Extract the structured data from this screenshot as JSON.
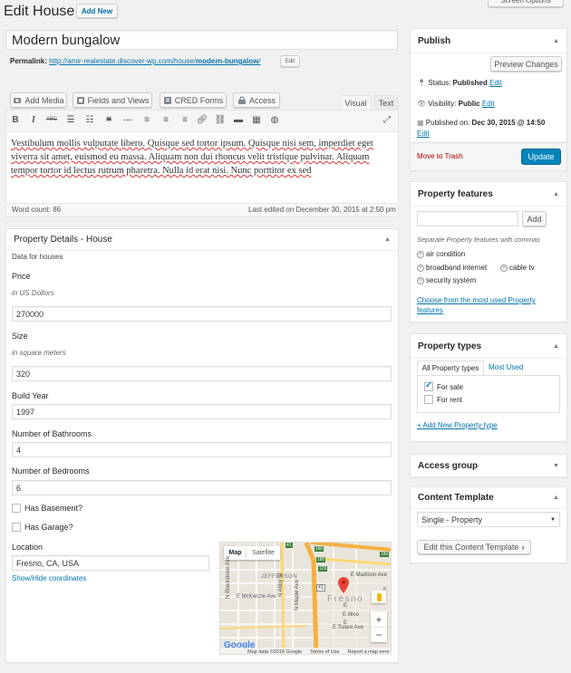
{
  "header": {
    "title": "Edit House",
    "add_new": "Add New",
    "screen_options": "Screen Options"
  },
  "post": {
    "title": "Modern bungalow",
    "permalink_label": "Permalink:",
    "permalink_base": "http://amir-realestate.discover-wp.com/house/",
    "permalink_slug": "modern-bungalow",
    "permalink_tail": "/",
    "edit_label": "Edit"
  },
  "media_buttons": {
    "add_media": "Add Media",
    "fields_views": "Fields and Views",
    "cred_forms": "CRED Forms",
    "access": "Access"
  },
  "editor": {
    "tab_visual": "Visual",
    "tab_text": "Text",
    "content": "Vestibulum mollis vulputate libero. Quisque sed tortor ipsum. Quisque nisi sem, imperdiet eget viverra sit amet, euismod eu massa. Aliquam non dui rhoncus velit tristique pulvinar. Aliquam tempor tortor id lectus rutrum pharetra. Nulla id erat nisi. Nunc porttitor ex sed",
    "word_count": "Word count: 86",
    "last_edited": "Last edited on December 30, 2015 at 2:50 pm"
  },
  "property_details": {
    "title": "Property Details - House",
    "description": "Data for houses",
    "price_label": "Price",
    "price_hint": "in US Dollors",
    "price_value": "270000",
    "size_label": "Size",
    "size_hint": "in square meters",
    "size_value": "320",
    "build_year_label": "Build Year",
    "build_year_value": "1997",
    "bathrooms_label": "Number of Bathrooms",
    "bathrooms_value": "4",
    "bedrooms_label": "Number of Bedrooms",
    "bedrooms_value": "6",
    "basement_label": "Has Basement?",
    "garage_label": "Has Garage?",
    "location_label": "Location",
    "location_value": "Fresno, CA, USA",
    "show_hide": "Show/Hide coordinates"
  },
  "map": {
    "tab_map": "Map",
    "tab_satellite": "Satellite",
    "city": "Fresno",
    "streets": {
      "jefferson": "JEFFERSON",
      "mckenzie": "E McKenzie Ave",
      "madison": "E Madison Ave",
      "blackstone": "N Blackstone Ave",
      "abby": "N Abby St",
      "maple": "N Maple Ave",
      "tulare": "E Tulare Ave",
      "elinor": "E Illino",
      "e": "E",
      "e2": "E",
      "e3": "E"
    },
    "shields": {
      "r180": "180",
      "r41": "41",
      "r180b": "180",
      "r41b": "41",
      "r129": "129",
      "r180c": "180"
    },
    "google": "Google",
    "footer_data": "Map data ©2016 Google",
    "footer_terms": "Terms of Use",
    "footer_report": "Report a map error",
    "zoom_in": "+",
    "zoom_out": "−"
  },
  "publish": {
    "title": "Publish",
    "preview": "Preview Changes",
    "status_label": "Status:",
    "status_value": "Published",
    "visibility_label": "Visibility:",
    "visibility_value": "Public",
    "published_label": "Published on:",
    "published_value": "Dec 30, 2015 @ 14:50",
    "edit": "Edit",
    "trash": "Move to Trash",
    "update": "Update"
  },
  "features": {
    "title": "Property features",
    "add": "Add",
    "hint": "Separate Property features with commas",
    "tags": [
      "air condition",
      "broadband internet",
      "cable tv",
      "security system"
    ],
    "choose": "Choose from the most used Property features"
  },
  "types": {
    "title": "Property types",
    "tab_all": "All Property types",
    "tab_most": "Most Used",
    "items": [
      {
        "label": "For sale",
        "checked": true
      },
      {
        "label": "For rent",
        "checked": false
      }
    ],
    "add_new": "+ Add New Property type"
  },
  "access_group": {
    "title": "Access group"
  },
  "content_template": {
    "title": "Content Template",
    "selected": "Single - Property",
    "edit_btn": "Edit this Content Template"
  },
  "colors": {
    "accent": "#0073aa",
    "primary_button": "#0085ba",
    "trash": "#a00"
  }
}
